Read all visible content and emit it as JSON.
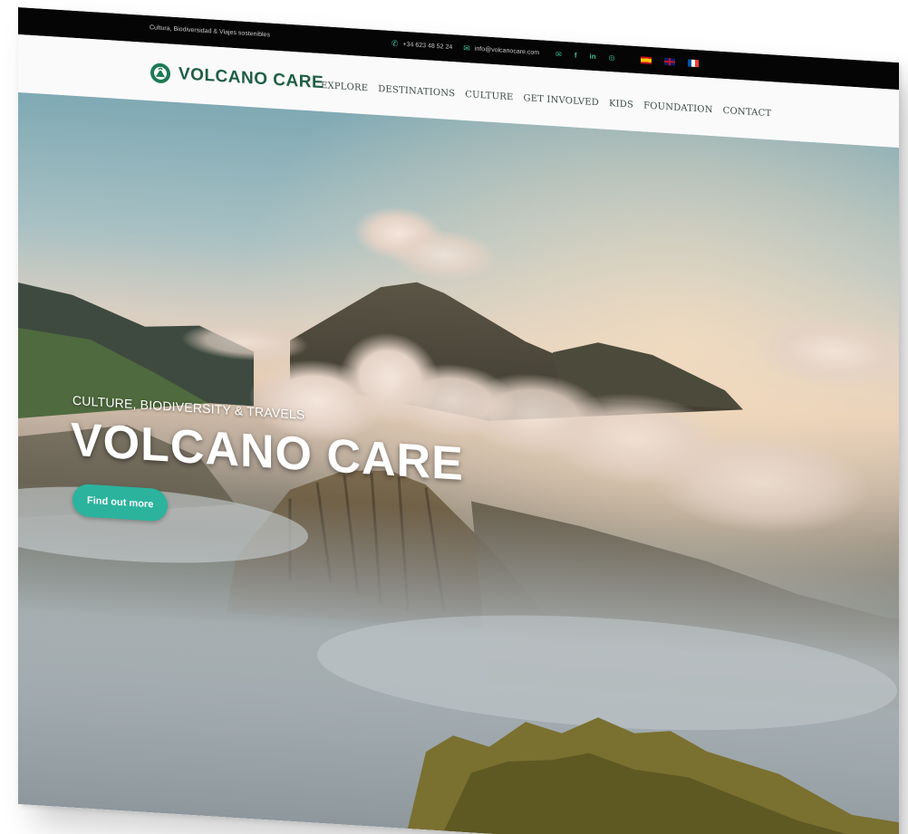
{
  "topbar": {
    "tagline": "Cultura, Biodiversidad & Viajes sostenibles",
    "phone": "+34 623 48 52 24",
    "email": "info@volcanocare.com",
    "social_icons": [
      "mail-icon",
      "facebook-icon",
      "linkedin-icon",
      "instagram-icon"
    ],
    "languages": [
      "es-flag",
      "uk-flag",
      "fr-flag"
    ]
  },
  "header": {
    "logo_text": "VOLCANO CARE",
    "nav": [
      "EXPLORE",
      "DESTINATIONS",
      "CULTURE",
      "GET INVOLVED",
      "KIDS",
      "FOUNDATION",
      "CONTACT"
    ]
  },
  "hero": {
    "subtitle": "CULTURE, BIODIVERSITY & TRAVELS",
    "title": "VOLCANO CARE",
    "cta": "Find out more"
  },
  "colors": {
    "brand_green": "#1f5e45",
    "accent_teal": "#2bb39d",
    "topbar_bg": "#050505"
  }
}
